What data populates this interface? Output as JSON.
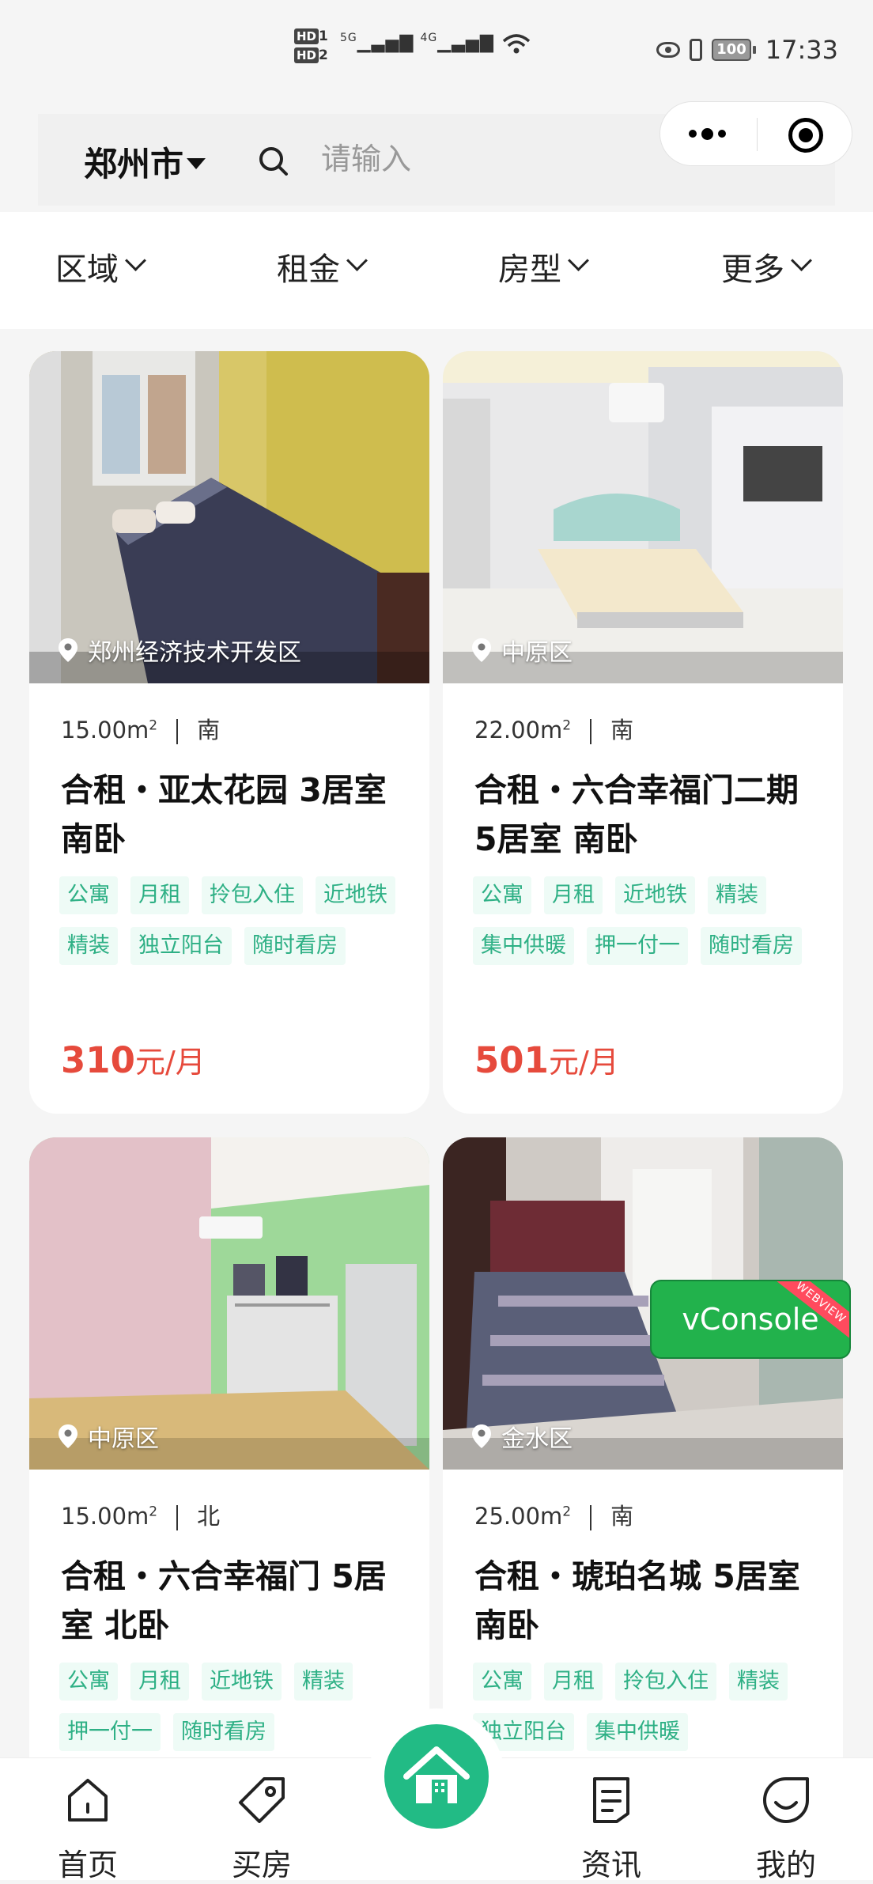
{
  "status_bar": {
    "hd_1": "HD",
    "hd_1_sub": "1",
    "hd_2": "HD",
    "hd_2_sub": "2",
    "net_1": "5G",
    "net_2": "4G",
    "battery": "100",
    "time": "17:33"
  },
  "header": {
    "city": "郑州市",
    "search_placeholder": "请输入"
  },
  "filters": [
    "区域",
    "租金",
    "房型",
    "更多"
  ],
  "listings": [
    {
      "location": "郑州经济技术开发区",
      "area": "15.00m",
      "area_unit_sup": "2",
      "orientation": "南",
      "title": "合租・亚太花园 3居室 南卧",
      "tags": [
        "公寓",
        "月租",
        "拎包入住",
        "近地铁",
        "精装",
        "独立阳台",
        "随时看房"
      ],
      "price": "310",
      "price_unit": "元/月"
    },
    {
      "location": "中原区",
      "area": "22.00m",
      "area_unit_sup": "2",
      "orientation": "南",
      "title": "合租・六合幸福门二期 5居室 南卧",
      "tags": [
        "公寓",
        "月租",
        "近地铁",
        "精装",
        "集中供暖",
        "押一付一",
        "随时看房"
      ],
      "price": "501",
      "price_unit": "元/月"
    },
    {
      "location": "中原区",
      "area": "15.00m",
      "area_unit_sup": "2",
      "orientation": "北",
      "title": "合租・六合幸福门 5居室 北卧",
      "tags": [
        "公寓",
        "月租",
        "近地铁",
        "精装",
        "押一付一",
        "随时看房"
      ]
    },
    {
      "location": "金水区",
      "area": "25.00m",
      "area_unit_sup": "2",
      "orientation": "南",
      "title": "合租・琥珀名城 5居室 南卧",
      "tags": [
        "公寓",
        "月租",
        "拎包入住",
        "精装",
        "独立阳台",
        "集中供暖"
      ]
    }
  ],
  "vconsole": {
    "label": "vConsole",
    "ribbon": "WEBVIEW"
  },
  "tabbar": {
    "tabs": [
      {
        "label": "首页",
        "icon": "home-icon"
      },
      {
        "label": "买房",
        "icon": "tag-icon"
      },
      {
        "label": "资讯",
        "icon": "news-icon"
      },
      {
        "label": "我的",
        "icon": "smile-icon"
      }
    ],
    "center_icon": "house-icon"
  },
  "colors": {
    "accent": "#22bb85",
    "tag_text": "#2eb085",
    "tag_bg": "#eefbf6",
    "price": "#e64a3c"
  }
}
